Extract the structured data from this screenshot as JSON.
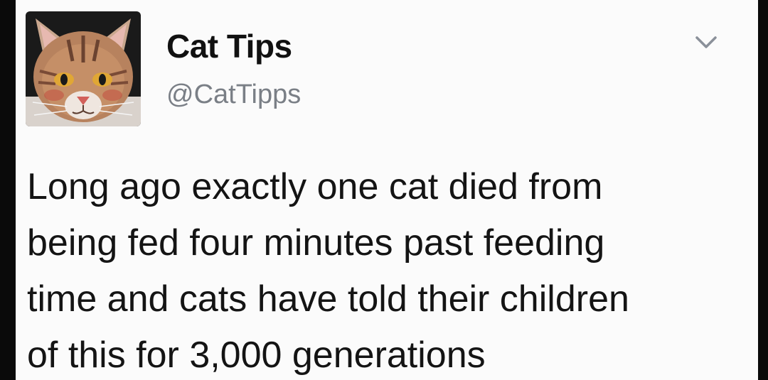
{
  "tweet": {
    "author": {
      "name": "Cat Tips",
      "handle": "@CatTipps",
      "avatar_icon": "cat-face-avatar"
    },
    "menu_icon": "chevron-down-icon",
    "text_lines": [
      "Long ago exactly one cat died from",
      "being fed four minutes past feeding",
      "time and cats have told their children",
      "of this for 3,000 generations"
    ]
  },
  "colors": {
    "card_background": "#fbfbfb",
    "frame_background": "#0a0a0a",
    "name_text": "#111111",
    "handle_text": "#7a7f86",
    "body_text": "#141414",
    "chevron": "#8a9099"
  }
}
